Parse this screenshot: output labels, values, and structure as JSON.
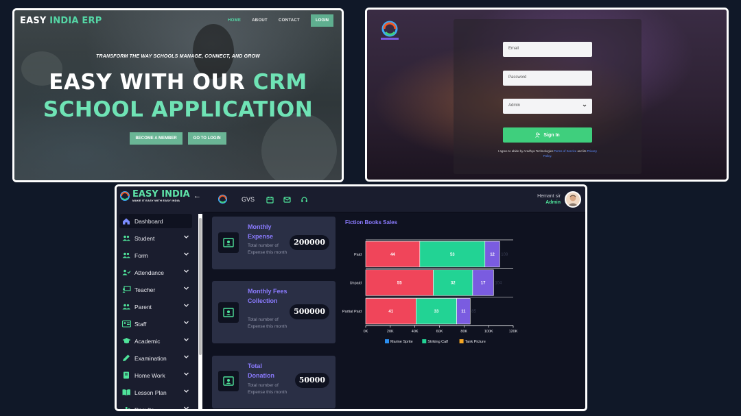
{
  "landing": {
    "brand_a": "EASY",
    "brand_b": "INDIA ERP",
    "nav": [
      {
        "label": "HOME",
        "active": true
      },
      {
        "label": "ABOUT",
        "active": false
      },
      {
        "label": "CONTACT",
        "active": false
      }
    ],
    "login_label": "LOGIN",
    "tagline": "TRANSFORM THE WAY SCHOOLS MANAGE, CONNECT, AND GROW",
    "headline_white": "EASY WITH OUR",
    "headline_accent": "CRM",
    "headline_line2": "SCHOOL APPLICATION",
    "cta_member": "BECOME A MEMBER",
    "cta_login": "GO TO LOGIN",
    "accent_color": "#6fe3b5"
  },
  "login": {
    "email_placeholder": "Email",
    "password_placeholder": "Password",
    "role_selected": "Admin",
    "signin_label": "Sign In",
    "terms_pre": "I agree to abide by Aradhya Technologies",
    "terms_link1": "Terms of Service",
    "terms_mid": "and its",
    "terms_link2": "Privacy Policy.",
    "button_color": "#3fcf7d"
  },
  "dashboard": {
    "brand": "EASY INDIA",
    "brand_sub": "MAKE IT EASY WITH EASY INDIA",
    "school_code": "GVS",
    "user_name": "Hemant sir",
    "user_role": "Admin",
    "menu": [
      {
        "label": "Dashboard",
        "icon": "home-icon",
        "active": true
      },
      {
        "label": "Student",
        "icon": "users-icon"
      },
      {
        "label": "Form",
        "icon": "users-icon"
      },
      {
        "label": "Attendance",
        "icon": "user-check-icon"
      },
      {
        "label": "Teacher",
        "icon": "chalkboard-icon"
      },
      {
        "label": "Parent",
        "icon": "users-icon"
      },
      {
        "label": "Staff",
        "icon": "id-card-icon"
      },
      {
        "label": "Academic",
        "icon": "graduation-cap-icon"
      },
      {
        "label": "Examination",
        "icon": "pen-icon"
      },
      {
        "label": "Home Work",
        "icon": "book-icon"
      },
      {
        "label": "Lesson Plan",
        "icon": "open-book-icon"
      },
      {
        "label": "Results",
        "icon": "chart-icon"
      }
    ],
    "cards": [
      {
        "title": "Monthly Expense",
        "desc": "Total number of Expense this month",
        "value": "200000"
      },
      {
        "title": "Monthly Fees Collection",
        "desc": "Total number of Expense this month",
        "value": "500000"
      },
      {
        "title": "Total Donation",
        "desc": "Total number of Expense this month",
        "value": "50000"
      }
    ]
  },
  "chart_data": {
    "type": "bar",
    "orientation": "horizontal",
    "stacked": true,
    "title": "Fiction Books Sales",
    "categories": [
      "Paid",
      "Unpaid",
      "Partial Paid"
    ],
    "series": [
      {
        "name": "Marine Sprite",
        "color": "#f0455a",
        "values": [
          44,
          55,
          41
        ],
        "labels": [
          "44",
          "55",
          "41"
        ]
      },
      {
        "name": "Striking Calf",
        "color": "#22d394",
        "values": [
          53,
          32,
          33
        ],
        "labels": [
          "53",
          "32",
          "33"
        ]
      },
      {
        "name": "Tank Picture",
        "color": "#7a5ce0",
        "values": [
          12,
          17,
          11
        ],
        "labels": [
          "12",
          "17",
          "11"
        ]
      }
    ],
    "totals": [
      "109",
      "104",
      "85"
    ],
    "x_ticks": [
      "0K",
      "20K",
      "40K",
      "60K",
      "80K",
      "100K",
      "120K"
    ],
    "xlim": [
      0,
      120
    ],
    "legend_colors": [
      "#2b8ef0",
      "#22d394",
      "#f5a623"
    ],
    "legend_position": "bottom",
    "grid": true
  }
}
